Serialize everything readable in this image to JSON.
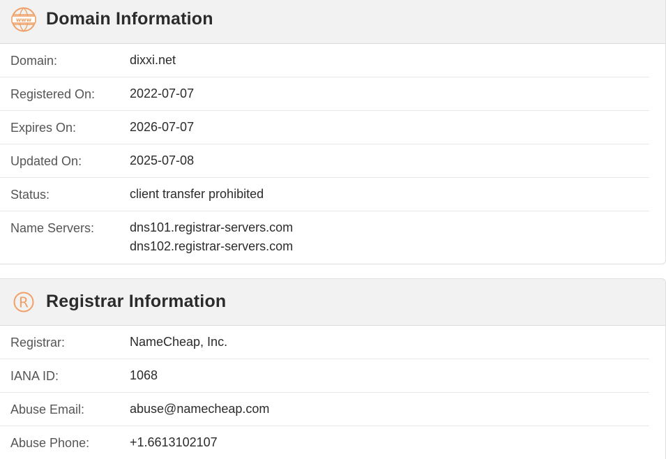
{
  "domain_info": {
    "title": "Domain Information",
    "icon": "www-globe-icon",
    "rows": [
      {
        "label": "Domain:",
        "value": "dixxi.net"
      },
      {
        "label": "Registered On:",
        "value": "2022-07-07"
      },
      {
        "label": "Expires On:",
        "value": "2026-07-07"
      },
      {
        "label": "Updated On:",
        "value": "2025-07-08"
      },
      {
        "label": "Status:",
        "value": "client transfer prohibited"
      }
    ],
    "name_servers": {
      "label": "Name Servers:",
      "values": [
        "dns101.registrar-servers.com",
        "dns102.registrar-servers.com"
      ]
    }
  },
  "registrar_info": {
    "title": "Registrar Information",
    "icon": "registered-mark-icon",
    "rows": [
      {
        "label": "Registrar:",
        "value": "NameCheap, Inc."
      },
      {
        "label": "IANA ID:",
        "value": "1068"
      },
      {
        "label": "Abuse Email:",
        "value": "abuse@namecheap.com"
      },
      {
        "label": "Abuse Phone:",
        "value": "+1.6613102107"
      }
    ]
  },
  "colors": {
    "accent": "#f0a066",
    "header_bg": "#f2f2f2",
    "label": "#555555",
    "value": "#2b2b2b"
  }
}
